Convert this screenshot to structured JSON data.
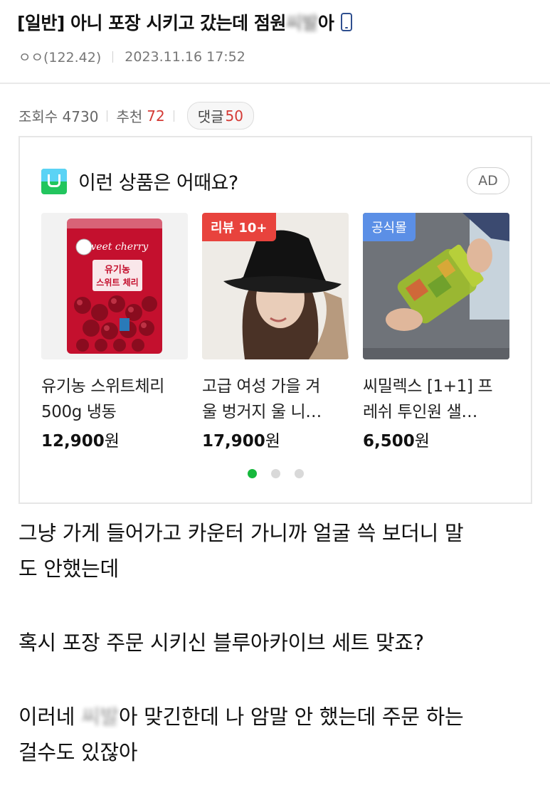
{
  "post": {
    "title_prefix": "[일반] 아니 포장 시키고 갔는데 점원 ",
    "title_blurred": "씨발",
    "title_suffix": "아",
    "author": "ㅇㅇ(122.42)",
    "datetime": "2023.11.16 17:52",
    "views_label": "조회수 4730",
    "recommend_label": "추천",
    "recommend_count": "72",
    "comments_label": "댓글",
    "comments_count": "50"
  },
  "ad": {
    "heading": "이런 상품은 어때요?",
    "badge": "AD",
    "products": [
      {
        "name_line1": "유기농 스위트체리",
        "name_line2": "500g 냉동",
        "price": "12,900",
        "unit": "원",
        "package_brand": "Sweet cherry",
        "package_title_1": "유기농",
        "package_title_2": "스위트 체리"
      },
      {
        "badge": "리뷰 10+",
        "name_line1": "고급 여성 가을 겨",
        "name_line2": "울 벙거지 울 니…",
        "price": "17,900",
        "unit": "원"
      },
      {
        "badge": "공식몰",
        "name_line1": "씨밀렉스 [1+1] 프",
        "name_line2": "레쉬 투인원 샐…",
        "price": "6,500",
        "unit": "원"
      }
    ],
    "pagination": {
      "total": 3,
      "active": 1
    }
  },
  "content": {
    "para1_line1": "그냥 가게 들어가고 카운터 가니까 얼굴 쓱 보더니 말",
    "para1_line2": "도 안했는데",
    "para2": "혹시 포장 주문 시키신 블루아카이브 세트 맞죠?",
    "para3_prefix": "이러네 ",
    "para3_blurred": "씨발",
    "para3_suffix": "아 맞긴한데 나 암말 안 했는데 주문 하는",
    "para3_line2": "걸수도 있잖아"
  },
  "colors": {
    "accent_red": "#d43a35",
    "dot_active": "#16b83c",
    "badge_review": "#e8433d",
    "badge_official": "#5b8fe6"
  }
}
